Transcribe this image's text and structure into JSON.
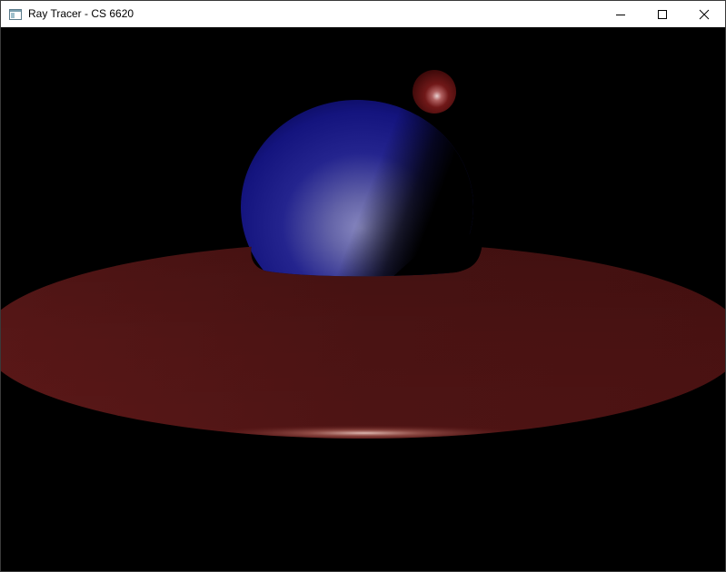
{
  "window": {
    "title": "Ray Tracer - CS 6620",
    "icon": "app-window-icon",
    "controls": {
      "minimize": "minimize-icon",
      "maximize": "maximize-icon",
      "close": "close-icon"
    }
  },
  "scene": {
    "background_color": "#000000",
    "objects": [
      {
        "name": "large-blue-sphere",
        "color": "#1a1a8c",
        "highlight": "#8a8ac0"
      },
      {
        "name": "small-red-sphere",
        "color": "#6a1414",
        "highlight": "#e0c0c0"
      },
      {
        "name": "red-disk-plane",
        "color": "#5a1616",
        "highlight": "#d8b0a8"
      }
    ]
  }
}
